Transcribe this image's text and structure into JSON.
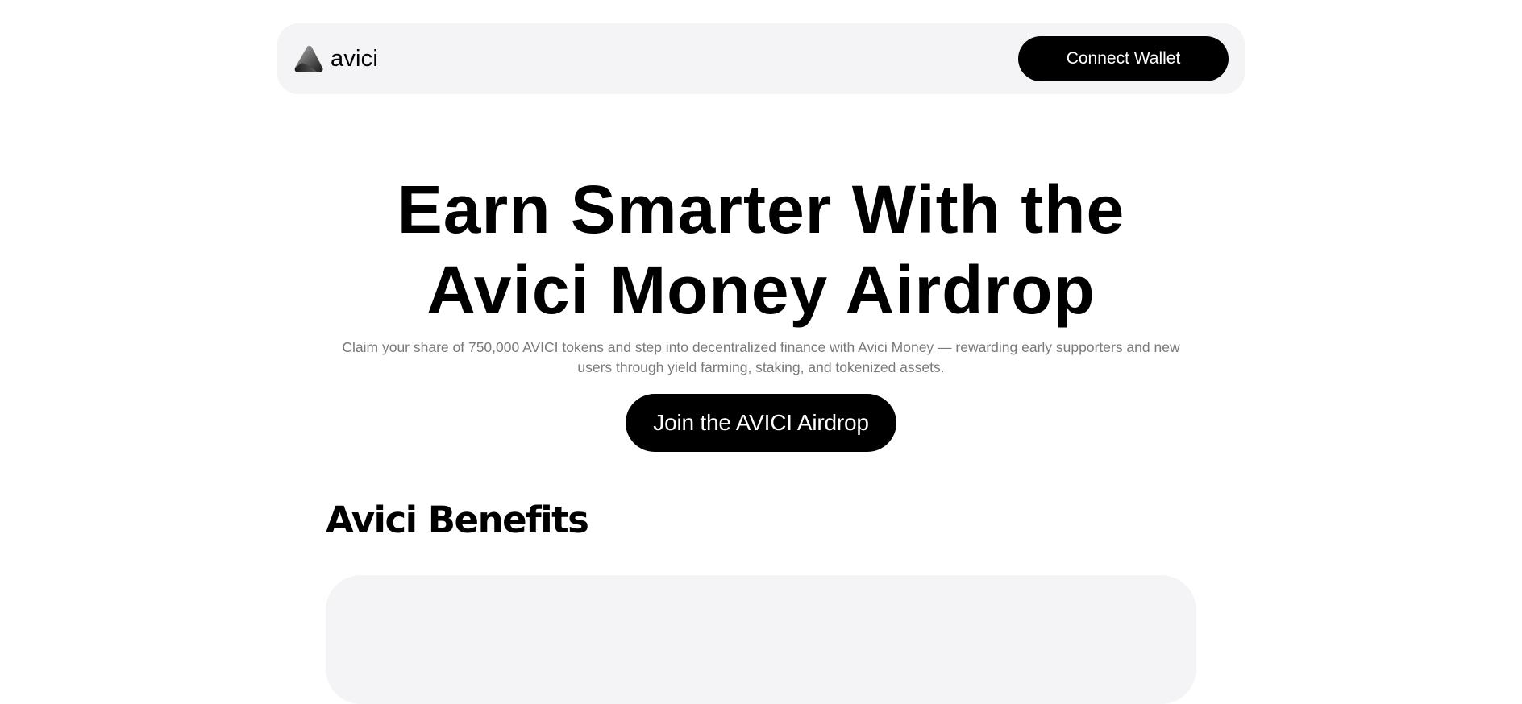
{
  "header": {
    "brand_name": "avici",
    "logo_icon": "triangle-logo-icon",
    "connect_label": "Connect Wallet"
  },
  "hero": {
    "title_line1": "Earn Smarter With the",
    "title_line2": "Avici Money Airdrop",
    "subtitle": "Claim your share of 750,000 AVICI tokens and step into decentralized finance with Avici Money — rewarding early supporters and new users through yield farming, staking, and tokenized assets.",
    "cta_label": "Join the AVICI Airdrop"
  },
  "benefits": {
    "title": "Avici Benefits"
  },
  "colors": {
    "background": "#ffffff",
    "panel": "#f4f4f6",
    "button": "#000000",
    "button_text": "#ffffff",
    "muted_text": "#7a7a7a"
  }
}
